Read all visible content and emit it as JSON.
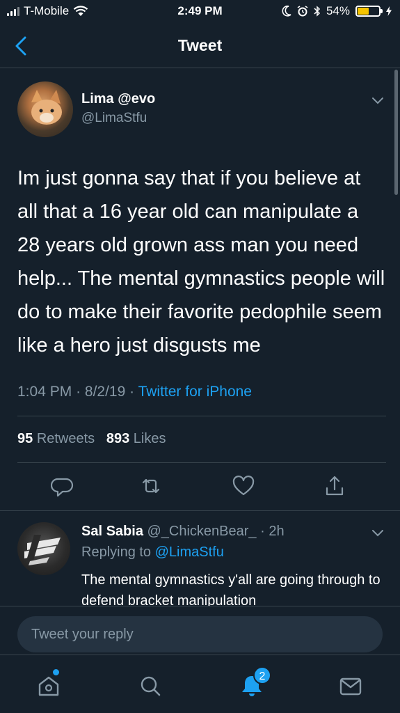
{
  "status_bar": {
    "carrier": "T-Mobile",
    "time": "2:49 PM",
    "battery": "54%",
    "battery_level": 0.54,
    "icons": [
      "signal-icon",
      "wifi-icon",
      "moon-icon",
      "alarm-icon",
      "bluetooth-icon",
      "battery-icon",
      "charging-icon"
    ]
  },
  "nav": {
    "title": "Tweet",
    "back_icon": "chevron-left-icon"
  },
  "tweet": {
    "author_name": "Lima @evo",
    "author_handle": "@LimaStfu",
    "text": "Im just gonna say that if you believe at all that a 16 year old can manipulate a 28 years old grown ass man you need help... The mental gymnastics people will do to make their favorite pedophile seem like a hero just disgusts me",
    "time": "1:04 PM",
    "date": "8/2/19",
    "source": "Twitter for iPhone",
    "retweet_count": "95",
    "retweet_label": "Retweets",
    "like_count": "893",
    "like_label": "Likes"
  },
  "reply": {
    "author_name": "Sal Sabia",
    "author_handle": "@_ChickenBear_",
    "age": "2h",
    "replying_label": "Replying to",
    "replying_to": "@LimaStfu",
    "text": "The mental gymnastics y'all are going through to defend bracket manipulation"
  },
  "composer": {
    "placeholder": "Tweet your reply"
  },
  "tab_bar": {
    "notifications_badge": "2",
    "tabs": [
      "home-icon",
      "search-icon",
      "notifications-icon",
      "messages-icon"
    ]
  },
  "colors": {
    "background": "#15202b",
    "accent": "#1da1f2",
    "secondary_text": "#8899a6",
    "divider": "#38444d",
    "battery": "#f5c400"
  }
}
